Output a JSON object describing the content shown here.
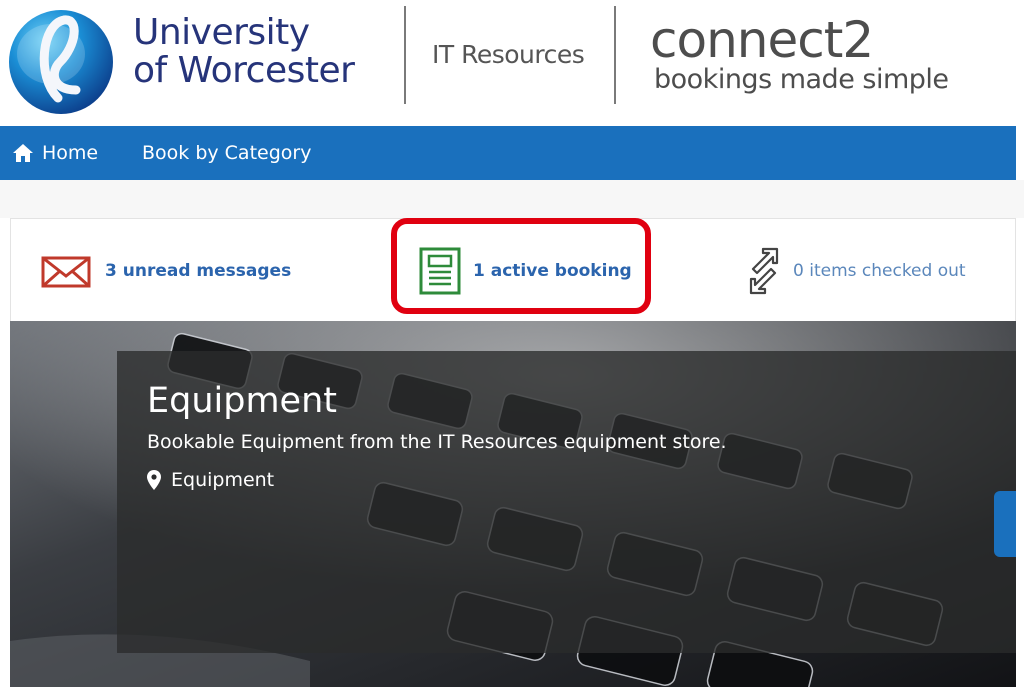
{
  "header": {
    "university_line1": "University",
    "university_line2": "of Worcester",
    "section": "IT Resources",
    "brand": "connect2",
    "tagline": "bookings made simple"
  },
  "nav": {
    "home": "Home",
    "book_by_category": "Book by Category",
    "color": "#1a70bd"
  },
  "status": {
    "messages": "3 unread messages",
    "bookings": "1 active booking",
    "checked_out": "0 items checked out",
    "highlight_color": "#e00010"
  },
  "hero": {
    "title": "Equipment",
    "description": "Bookable Equipment from the IT Resources equipment store.",
    "location": "Equipment"
  },
  "icons": [
    "university-logo-icon",
    "home-icon",
    "envelope-icon",
    "booking-document-icon",
    "transfer-arrows-icon",
    "map-pin-icon"
  ]
}
